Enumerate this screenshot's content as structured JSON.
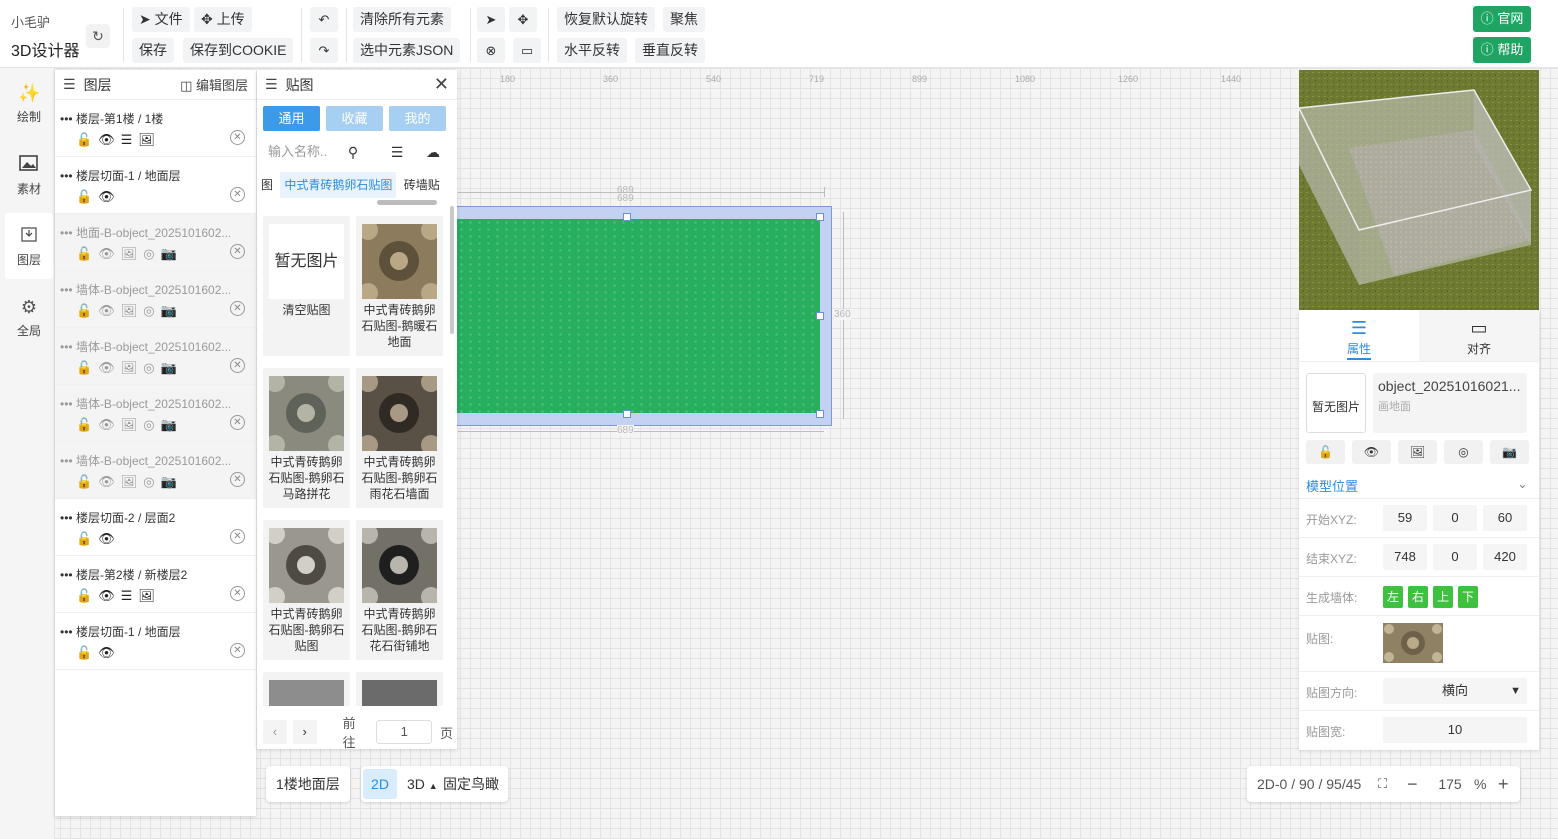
{
  "app": {
    "subtitle": "小毛驴",
    "title": "3D设计器"
  },
  "toolbar": {
    "file": "文件",
    "upload": "上传",
    "save": "保存",
    "save_cookie": "保存到COOKIE",
    "clear_all": "清除所有元素",
    "selected_json": "选中元素JSON",
    "restore_rotation": "恢复默认旋转",
    "focus": "聚焦",
    "flip_h": "水平反转",
    "flip_v": "垂直反转",
    "website": "官网",
    "help": "帮助"
  },
  "leftnav": {
    "draw": "绘制",
    "material": "素材",
    "layers": "图层",
    "global": "全局"
  },
  "layers_panel": {
    "title": "图层",
    "edit": "编辑图层",
    "items": [
      {
        "name": "楼层-第1楼 / 1楼",
        "dim": false,
        "icons": [
          "lock-open",
          "eye",
          "menu",
          "image"
        ]
      },
      {
        "name": "楼层切面-1 / 地面层",
        "dim": false,
        "icons": [
          "lock-open",
          "eye"
        ]
      },
      {
        "name": "地面-B-object_2025101602...",
        "dim": true,
        "icons": [
          "lock-open",
          "eye",
          "image",
          "target",
          "camera"
        ]
      },
      {
        "name": "墙体-B-object_2025101602...",
        "dim": true,
        "icons": [
          "lock-open",
          "eye",
          "image",
          "target",
          "camera"
        ]
      },
      {
        "name": "墙体-B-object_2025101602...",
        "dim": true,
        "icons": [
          "lock-open",
          "eye",
          "image",
          "target",
          "camera"
        ]
      },
      {
        "name": "墙体-B-object_2025101602...",
        "dim": true,
        "icons": [
          "lock-open",
          "eye",
          "image",
          "target",
          "camera"
        ]
      },
      {
        "name": "墙体-B-object_2025101602...",
        "dim": true,
        "icons": [
          "lock-open",
          "eye",
          "image",
          "target",
          "camera"
        ]
      },
      {
        "name": "楼层切面-2 / 层面2",
        "dim": false,
        "icons": [
          "lock-open",
          "eye"
        ]
      },
      {
        "name": "楼层-第2楼 / 新楼层2",
        "dim": false,
        "icons": [
          "lock-open",
          "eye",
          "menu",
          "image"
        ]
      },
      {
        "name": "楼层切面-1 / 地面层",
        "dim": false,
        "icons": [
          "lock-open",
          "eye"
        ]
      }
    ]
  },
  "texture_panel": {
    "title": "贴图",
    "tabs": [
      "通用",
      "收藏",
      "我的"
    ],
    "search_placeholder": "输入名称..",
    "categories": [
      "图",
      "中式青砖鹅卵石贴图",
      "砖墙贴"
    ],
    "items": [
      {
        "label": "清空贴图",
        "placeholder": "暂无图片"
      },
      {
        "label": "中式青砖鹅卵石贴图-鹅暖石地面"
      },
      {
        "label": "中式青砖鹅卵石贴图-鹅卵石马路拼花"
      },
      {
        "label": "中式青砖鹅卵石贴图-鹅卵石雨花石墙面"
      },
      {
        "label": "中式青砖鹅卵石贴图-鹅卵石贴图"
      },
      {
        "label": "中式青砖鹅卵石贴图-鹅卵石花石街铺地"
      }
    ],
    "pager": {
      "goto": "前往",
      "page": "1",
      "unit": "页"
    }
  },
  "ruler": [
    "180",
    "360",
    "540",
    "719",
    "899",
    "1080",
    "1260",
    "1440"
  ],
  "dimensions": {
    "top": "689",
    "bottom": "689",
    "right": "360"
  },
  "properties": {
    "tab_props": "属性",
    "tab_align": "对齐",
    "thumb_placeholder": "暂无图片",
    "object_name": "object_20251016021...",
    "object_type": "画地面",
    "section": "模型位置",
    "start_label": "开始XYZ:",
    "start": [
      "59",
      "0",
      "60"
    ],
    "end_label": "结束XYZ:",
    "end": [
      "748",
      "0",
      "420"
    ],
    "walls_label": "生成墙体:",
    "walls": [
      "左",
      "右",
      "上",
      "下"
    ],
    "texture_label": "贴图:",
    "direction_label": "贴图方向:",
    "direction": "横向",
    "width_label": "贴图宽:",
    "width": "10"
  },
  "bottom": {
    "floor": "1楼地面层",
    "mode2d": "2D",
    "mode3d": "3D",
    "birdseye": "固定鸟瞰",
    "view_info": "2D-0 / 90 / 95/45",
    "zoom": "175",
    "zoom_unit": "%"
  }
}
